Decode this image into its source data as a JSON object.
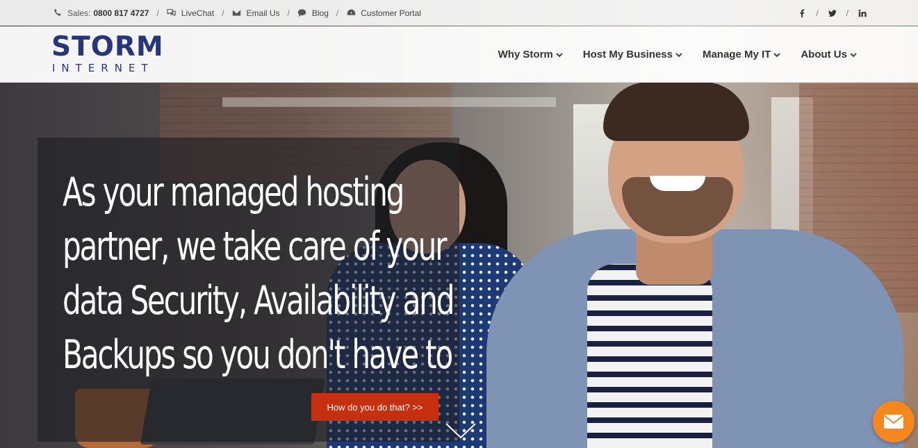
{
  "topbar": {
    "sales_label": "Sales:",
    "sales_number": "0800 817 4727",
    "livechat": "LiveChat",
    "email": "Email Us",
    "blog": "Blog",
    "portal": "Customer Portal",
    "separator": "/",
    "social_icons": [
      "facebook-icon",
      "twitter-icon",
      "linkedin-icon"
    ]
  },
  "logo": {
    "line1": "STORM",
    "line2": "INTERNET"
  },
  "nav": {
    "items": [
      {
        "label": "Why Storm"
      },
      {
        "label": "Host My Business"
      },
      {
        "label": "Manage My IT"
      },
      {
        "label": "About Us"
      }
    ]
  },
  "hero": {
    "headline_lines": [
      "As your managed hosting",
      "partner, we take care of your",
      "data Security, Availability and",
      "Backups so you don't have to"
    ],
    "cta_label": "How do you do that? >>"
  },
  "colors": {
    "brand_navy": "#27357a",
    "cta_red": "#c6300e",
    "chat_orange": "#f6871f"
  }
}
